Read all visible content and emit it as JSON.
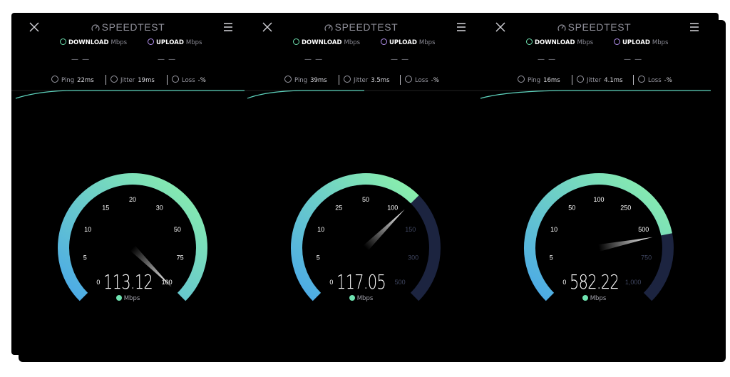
{
  "app": {
    "logo_text": "SPEEDTEST"
  },
  "labels": {
    "download": "DOWNLOAD",
    "upload": "UPLOAD",
    "mbps": "Mbps",
    "ping": "Ping",
    "jitter": "Jitter",
    "loss": "Loss",
    "dash": "— —"
  },
  "colors": {
    "background": "#000000",
    "gauge_start": "#4aa8e8",
    "gauge_end": "#8df2a9",
    "gauge_track": "#1c2440",
    "upload_accent": "#b794f4",
    "download_accent": "#6fe3b1"
  },
  "icons": [
    "close-icon",
    "speedtest-logo-icon",
    "menu-icon",
    "download-icon",
    "upload-icon",
    "ping-icon",
    "jitter-icon",
    "loss-icon"
  ],
  "panels": [
    {
      "ping": "22ms",
      "jitter": "19ms",
      "loss": "-%",
      "speed": "113.12",
      "speed_value": 113.12,
      "ticks": [
        "0",
        "5",
        "10",
        "15",
        "20",
        "30",
        "50",
        "75",
        "100"
      ],
      "tick_values": [
        0,
        5,
        10,
        15,
        20,
        30,
        50,
        75,
        100
      ],
      "scale_max_index": 8
    },
    {
      "ping": "39ms",
      "jitter": "3.5ms",
      "loss": "-%",
      "speed": "117.05",
      "speed_value": 117.05,
      "ticks": [
        "0",
        "5",
        "10",
        "25",
        "50",
        "100",
        "150",
        "300",
        "500"
      ],
      "tick_values": [
        0,
        5,
        10,
        25,
        50,
        100,
        150,
        300,
        500
      ],
      "scale_max_index": 8
    },
    {
      "ping": "16ms",
      "jitter": "4.1ms",
      "loss": "-%",
      "speed": "582.22",
      "speed_value": 582.22,
      "ticks": [
        "0",
        "5",
        "10",
        "50",
        "100",
        "250",
        "500",
        "750",
        "1,000"
      ],
      "tick_values": [
        0,
        5,
        10,
        50,
        100,
        250,
        500,
        750,
        1000
      ],
      "scale_max_index": 8
    }
  ]
}
